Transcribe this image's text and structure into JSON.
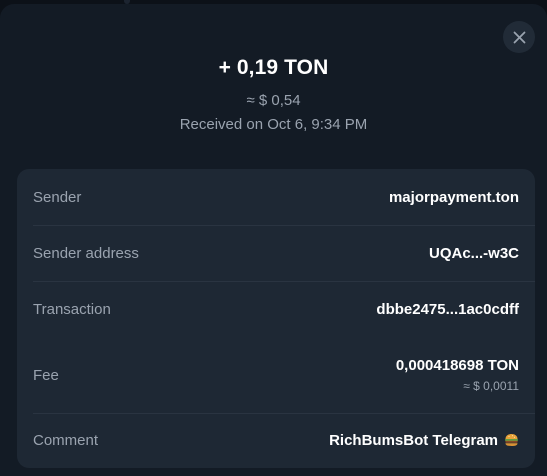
{
  "transaction": {
    "amount": "+ 0,19 TON",
    "fiat_amount": "≈ $ 0,54",
    "received": "Received on Oct 6, 9:34 PM"
  },
  "details": {
    "sender_label": "Sender",
    "sender_value": "majorpayment.ton",
    "address_label": "Sender address",
    "address_value": "UQAc...-w3C",
    "transaction_label": "Transaction",
    "transaction_value": "dbbe2475...1ac0cdff",
    "fee_label": "Fee",
    "fee_value": "0,000418698 TON",
    "fee_fiat": "≈ $ 0,0011",
    "comment_label": "Comment",
    "comment_value": "RichBumsBot Telegram"
  },
  "icons": {
    "close": "close-icon",
    "comment_emoji": "burger-icon"
  },
  "colors": {
    "background": "#131b25",
    "card": "#1e2834",
    "muted_text": "#9aa3af",
    "primary_text": "#ffffff"
  }
}
